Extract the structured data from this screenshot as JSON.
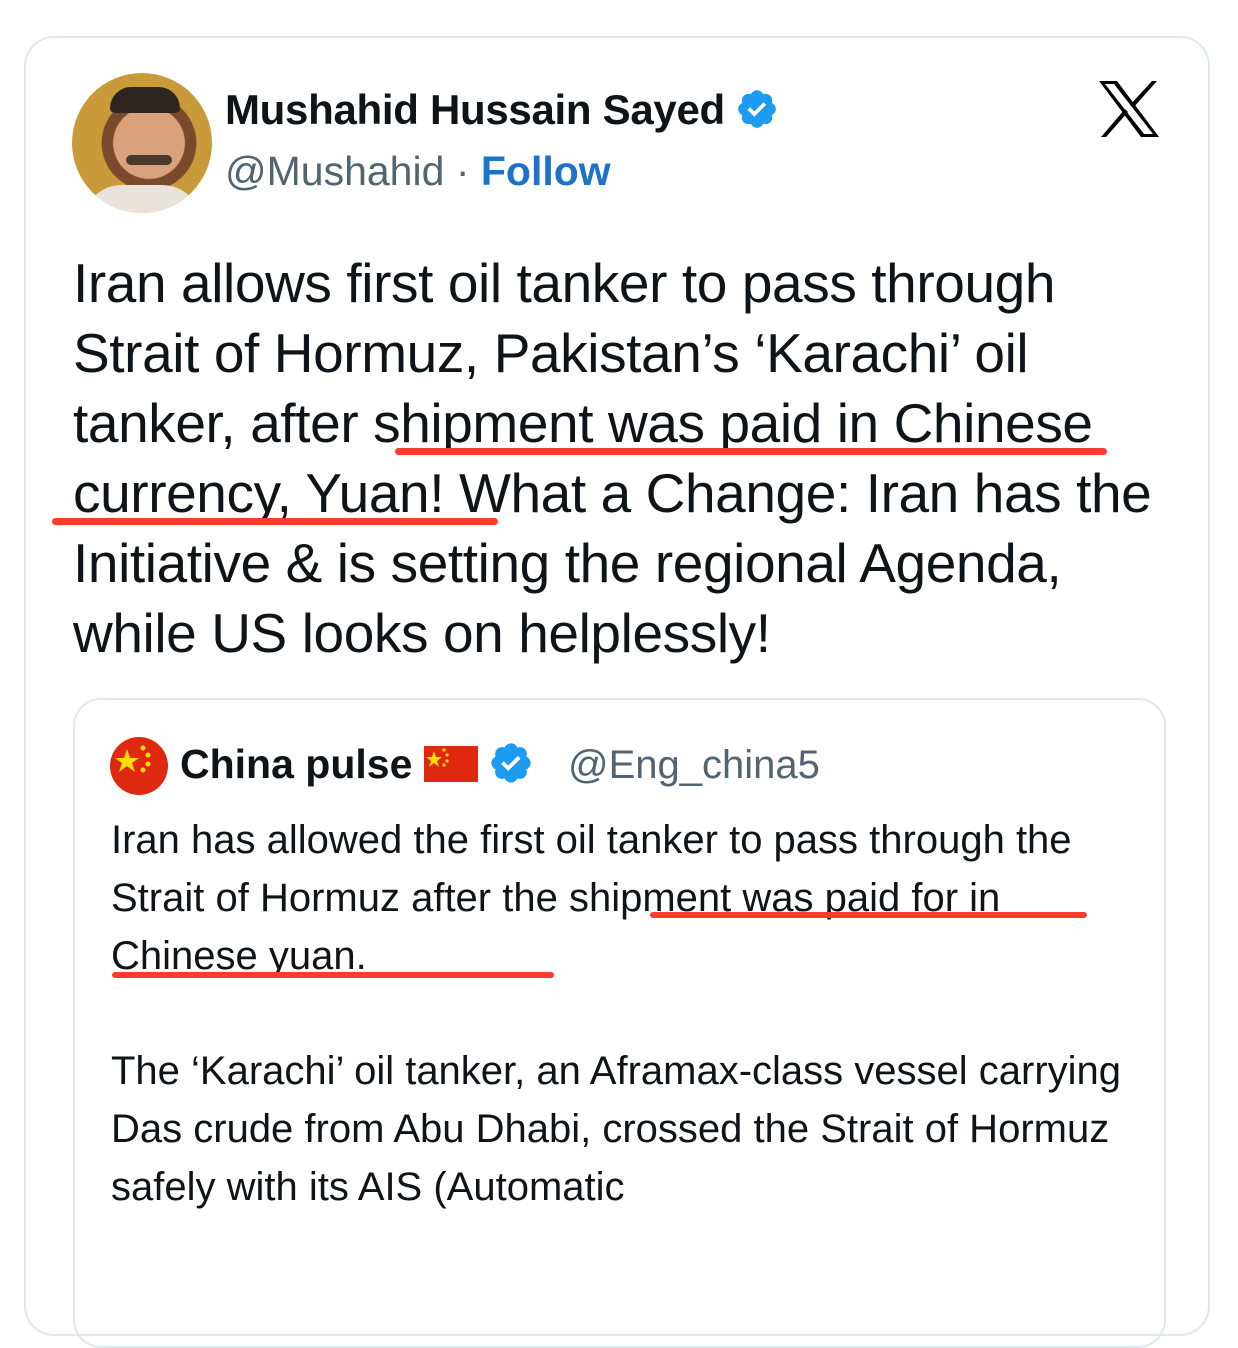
{
  "author": {
    "name": "Mushahid Hussain Sayed",
    "handle": "@Mushahid",
    "separator": "·",
    "follow_label": "Follow"
  },
  "tweet": {
    "text": "Iran allows first oil tanker to pass through Strait of Hormuz, Pakistan’s ‘Karachi’ oil tanker, after shipment was paid in Chinese currency, Yuan! What a Change: Iran has the Initiative & is setting the regional Agenda, while US looks on helplessly!"
  },
  "quote": {
    "name": "China pulse",
    "handle": "@Eng_china5",
    "text_1": "Iran has allowed the first oil tanker to pass through the Strait of Hormuz after the shipment was paid for in Chinese yuan.",
    "text_2": "The ‘Karachi’ oil tanker, an Aframax-class vessel carrying Das crude from Abu Dhabi, crossed the Strait of Hormuz safely with its AIS (Automatic"
  },
  "icons": {
    "verified": "verified-badge-icon",
    "platform": "x-logo-icon",
    "flag": "china-flag-icon"
  },
  "colors": {
    "verified": "#1d9bf0",
    "follow": "#1d73c9",
    "underline": "#ff3b30",
    "secondary_text": "#536471"
  }
}
